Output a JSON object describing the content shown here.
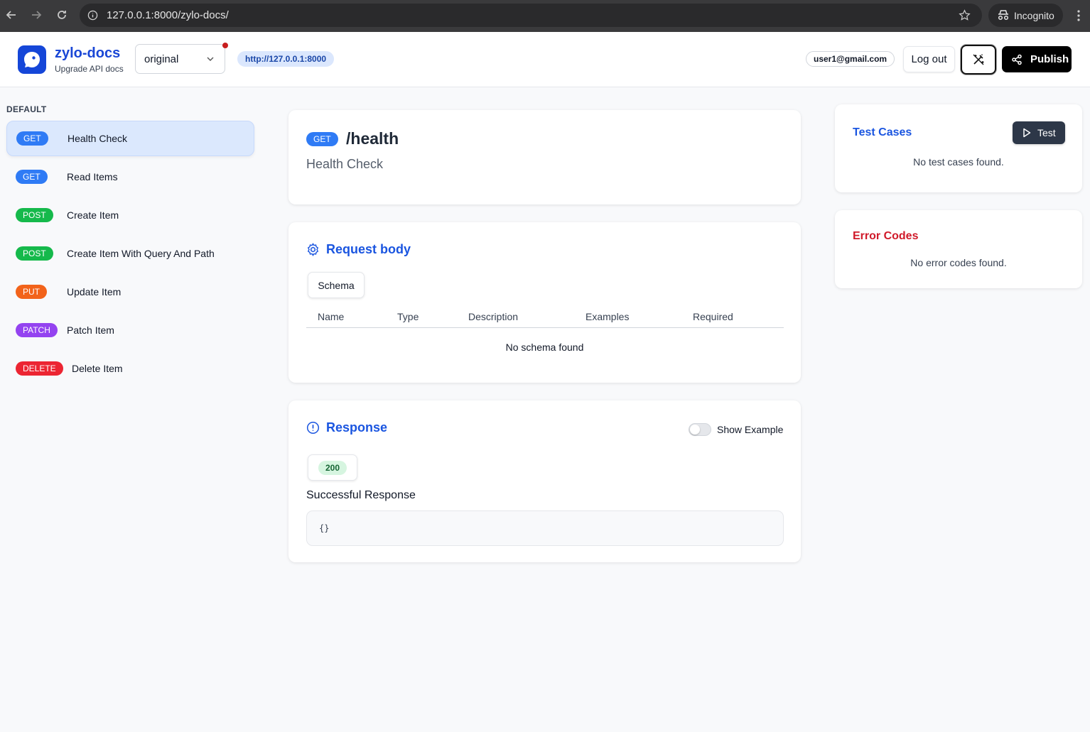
{
  "browser": {
    "url": "127.0.0.1:8000/zylo-docs/",
    "mode_label": "Incognito"
  },
  "header": {
    "brand_name": "zylo-docs",
    "brand_subtitle": "Upgrade API docs",
    "version_selected": "original",
    "base_url": "http://127.0.0.1:8000",
    "user_email": "user1@gmail.com",
    "logout_label": "Log out",
    "publish_label": "Publish"
  },
  "sidebar": {
    "heading": "DEFAULT",
    "items": [
      {
        "method": "GET",
        "label": "Health Check"
      },
      {
        "method": "GET",
        "label": "Read Items"
      },
      {
        "method": "POST",
        "label": "Create Item"
      },
      {
        "method": "POST",
        "label": "Create Item With Query And Path"
      },
      {
        "method": "PUT",
        "label": "Update Item"
      },
      {
        "method": "PATCH",
        "label": "Patch Item"
      },
      {
        "method": "DELETE",
        "label": "Delete Item"
      }
    ]
  },
  "endpoint": {
    "method": "GET",
    "path": "/health",
    "summary": "Health Check"
  },
  "request_body": {
    "title": "Request body",
    "tab_label": "Schema",
    "columns": [
      "Name",
      "Type",
      "Description",
      "Examples",
      "Required"
    ],
    "empty_text": "No schema found"
  },
  "response": {
    "title": "Response",
    "toggle_label": "Show Example",
    "toggle_on": false,
    "status_code": "200",
    "description": "Successful Response",
    "body": "{}"
  },
  "test_cases": {
    "title": "Test Cases",
    "button_label": "Test",
    "empty_text": "No test cases found."
  },
  "error_codes": {
    "title": "Error Codes",
    "empty_text": "No error codes found."
  },
  "colors": {
    "brand": "#1a47d6",
    "get": "#2f7bf5",
    "post": "#15b94b",
    "put": "#f2631a",
    "patch": "#9443f0",
    "delete": "#ec2532",
    "error_title": "#d01a2a"
  }
}
